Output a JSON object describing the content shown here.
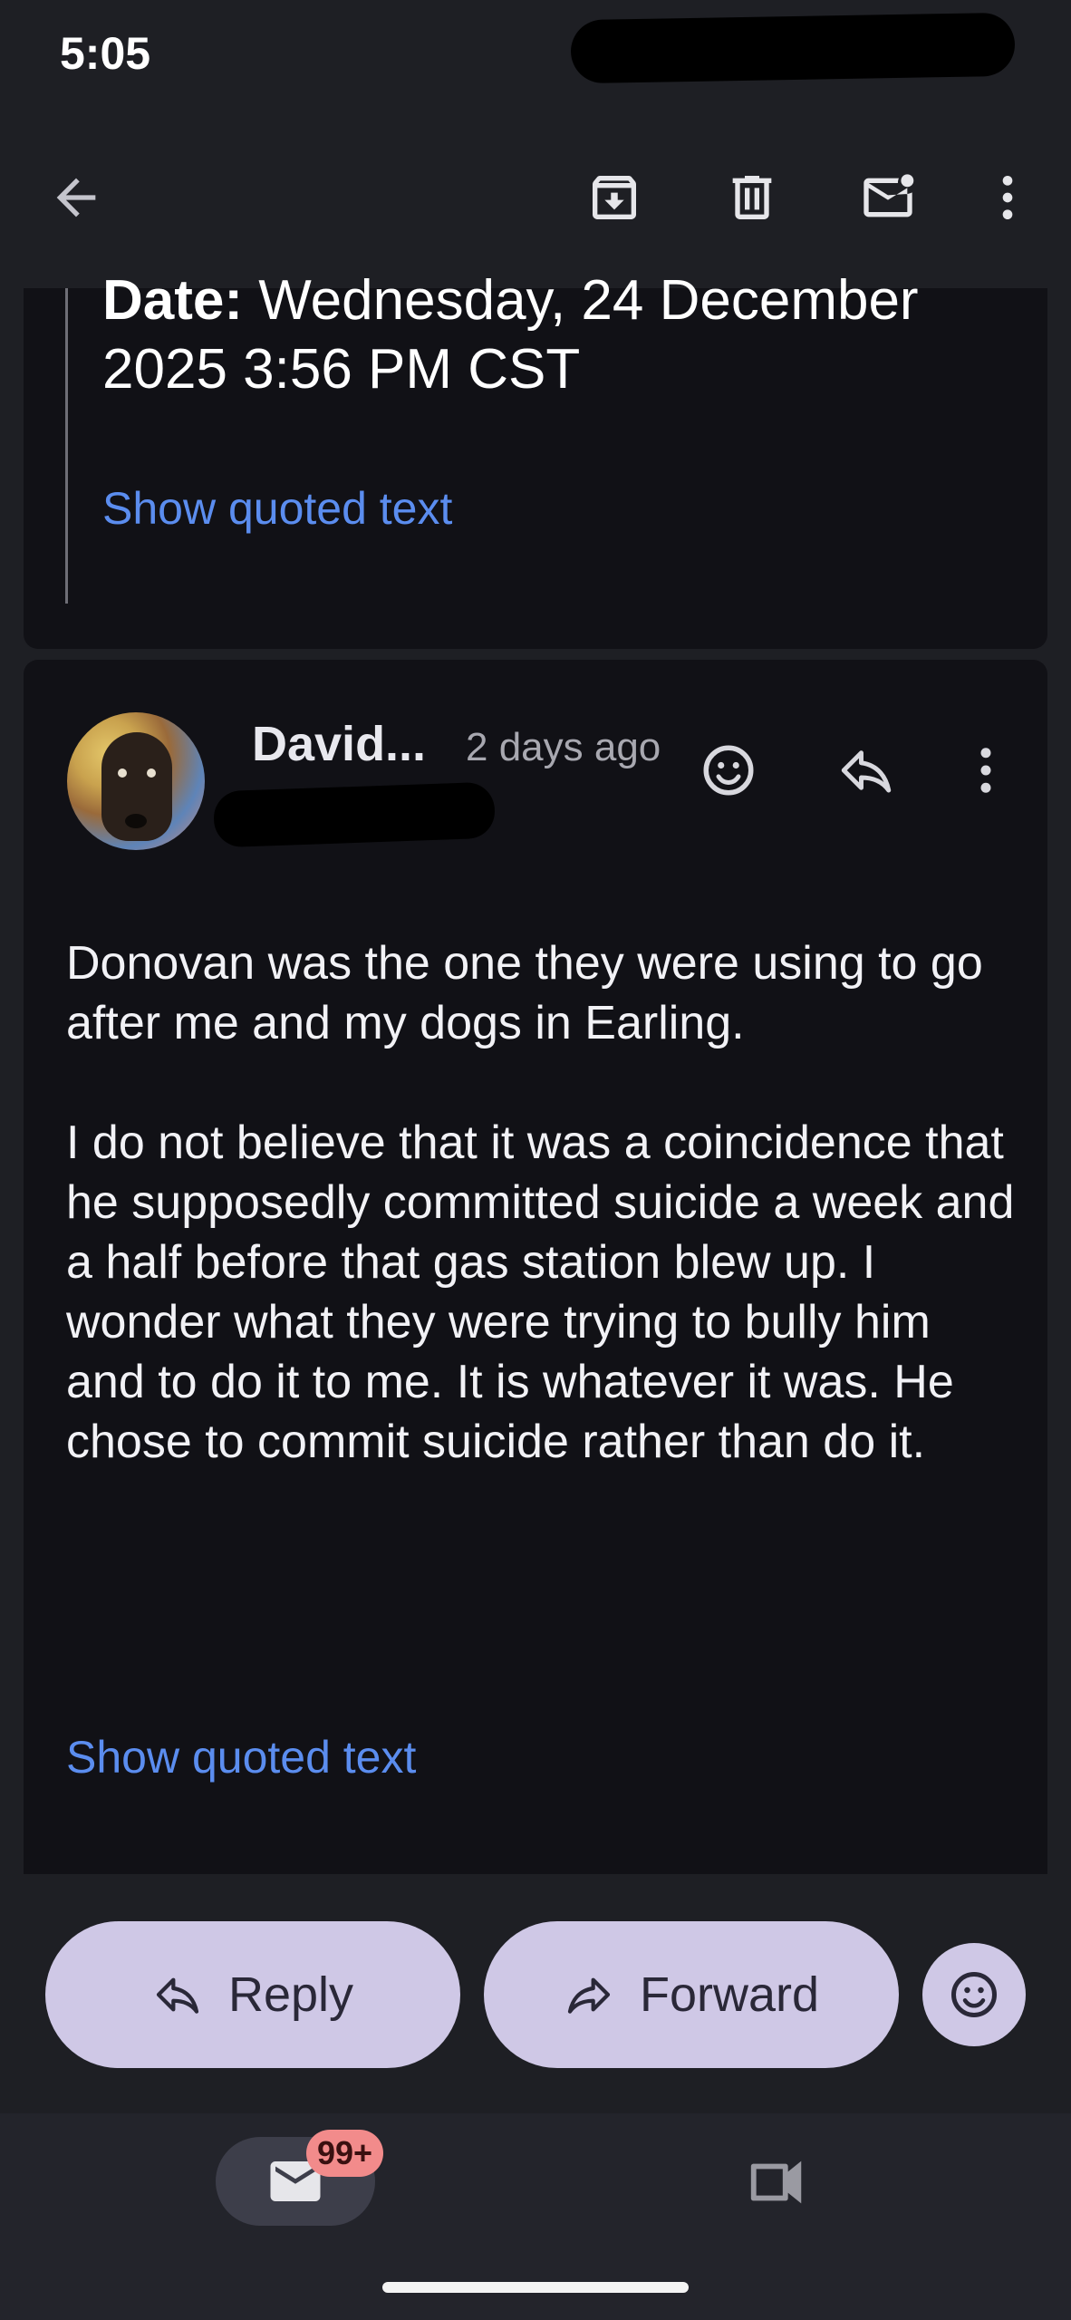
{
  "status_bar": {
    "time": "5:05"
  },
  "toolbar": {
    "back_icon": "arrow-left-icon",
    "archive_icon": "archive-icon",
    "delete_icon": "trash-icon",
    "mark_unread_icon": "mark-unread-icon",
    "more_icon": "more-vert-icon"
  },
  "quoted_header": {
    "date_label": "Date:",
    "date_value_line1": " Wednesday, 24 December",
    "date_value_line2": "2025 3:56 PM CST",
    "show_quoted": "Show quoted text"
  },
  "message": {
    "sender": "David...",
    "time": "2 days ago",
    "body": [
      "Donovan was the one they were using to go after me and my dogs in Earling.",
      "I do not believe that it was a coincidence that he supposedly committed suicide a week and a half before that gas station blew up. I wonder what they were trying to bully him and to do it to me. It is whatever it was. He chose to commit suicide rather than do it."
    ],
    "show_quoted": "Show quoted text"
  },
  "actions": {
    "reply": "Reply",
    "forward": "Forward"
  },
  "bottom_nav": {
    "mail_badge": "99+"
  },
  "colors": {
    "background": "#1e1f24",
    "card": "#111116",
    "link": "#5b8def",
    "pill": "#cfc8e6",
    "badge": "#f28b8b"
  }
}
